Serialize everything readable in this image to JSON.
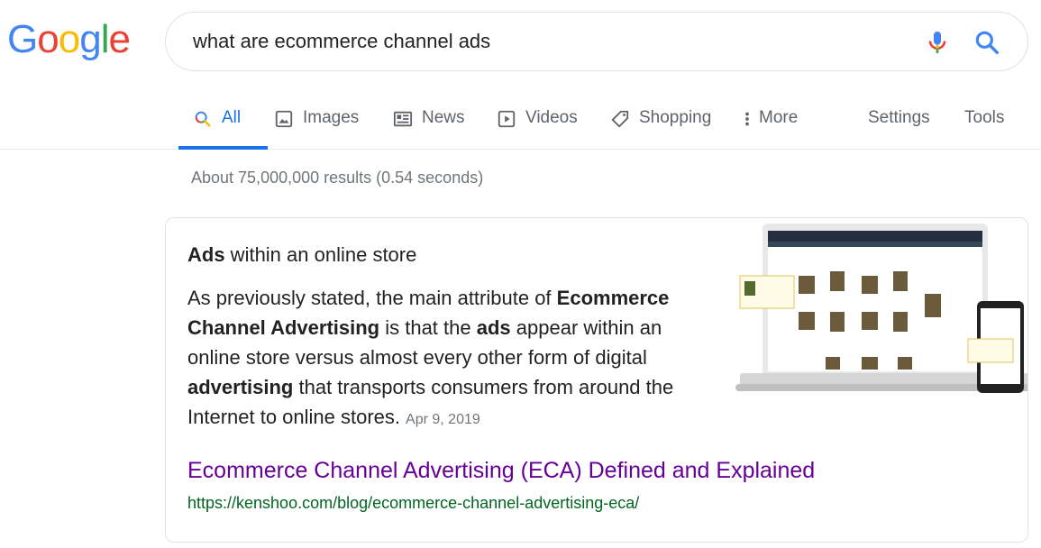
{
  "logo": {
    "letters": [
      "G",
      "o",
      "o",
      "g",
      "l",
      "e"
    ]
  },
  "search": {
    "query": "what are ecommerce channel ads"
  },
  "tabs": [
    {
      "label": "All",
      "icon": "search-icon",
      "active": true
    },
    {
      "label": "Images",
      "icon": "image-icon"
    },
    {
      "label": "News",
      "icon": "news-icon"
    },
    {
      "label": "Videos",
      "icon": "play-icon"
    },
    {
      "label": "Shopping",
      "icon": "tag-icon"
    },
    {
      "label": "More",
      "icon": "more-vert-icon"
    },
    {
      "label": "Settings"
    },
    {
      "label": "Tools"
    }
  ],
  "stats": "About 75,000,000 results (0.54 seconds)",
  "featured": {
    "heading_bold": "Ads",
    "heading_rest": " within an online store",
    "snippet": [
      {
        "t": "As previously stated, the main attribute of ",
        "b": false
      },
      {
        "t": "Ecommerce Channel Advertising",
        "b": true
      },
      {
        "t": " is that the ",
        "b": false
      },
      {
        "t": "ads",
        "b": true
      },
      {
        "t": " appear within an online store versus almost every other form of digital ",
        "b": false
      },
      {
        "t": "advertising",
        "b": true
      },
      {
        "t": " that transports consumers from around the Internet to online stores.",
        "b": false
      }
    ],
    "date": "Apr 9, 2019",
    "result_title": "Ecommerce Channel Advertising (ECA) Defined and Explained",
    "result_url": "https://kenshoo.com/blog/ecommerce-channel-advertising-eca/"
  }
}
